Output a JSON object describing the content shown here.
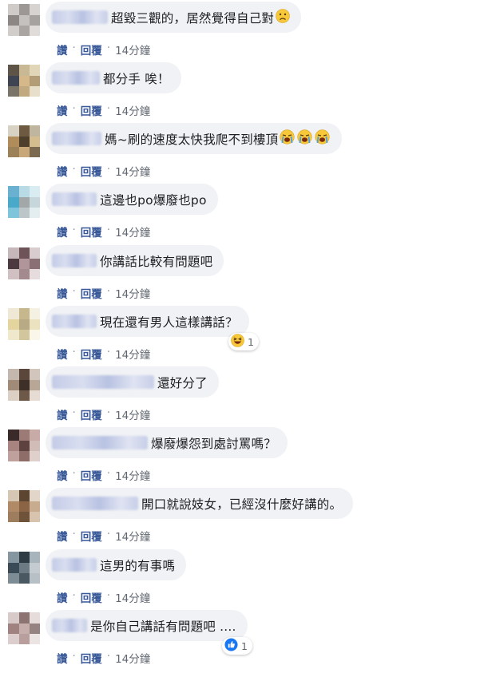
{
  "actions": {
    "like": "讚",
    "reply": "回覆",
    "separator": "·",
    "time": "14分鐘"
  },
  "comments": [
    {
      "text": "超毀三觀的，居然覺得自己對",
      "emoji": "disappointed-face-icon",
      "avatar_color": "#b7b3b1"
    },
    {
      "text": "都分手 唉！",
      "avatar_color": "#a89a7c"
    },
    {
      "text": "媽~刷的速度太快我爬不到樓頂",
      "emoji": "crying-face-icon",
      "emoji_count": 3,
      "avatar_color": "#8a7a5c"
    },
    {
      "text": "這邊也po爆廢也po",
      "avatar_color": "#8fb8c6"
    },
    {
      "text": "你講話比較有問題吧",
      "avatar_color": "#9b8a8c"
    },
    {
      "text": "現在還有男人這樣講話？",
      "reaction": {
        "icon": "haha-reaction-icon",
        "count": "1"
      },
      "avatar_color": "#d8cfae"
    },
    {
      "text": "還好分了",
      "avatar_color": "#8c7a6a"
    },
    {
      "text": "爆廢爆怨到處討罵嗎？",
      "avatar_color": "#7a5a58"
    },
    {
      "text": "開口就說妓女，已經沒什麼好講的。",
      "avatar_color": "#8c6f56"
    },
    {
      "text": "這男的有事嗎",
      "avatar_color": "#4e5e68"
    },
    {
      "text": "是你自己講話有問題吧 ....",
      "reaction": {
        "icon": "like-reaction-icon",
        "count": "1"
      },
      "avatar_color": "#b09a98"
    }
  ],
  "colors": {
    "bubble": "#f0f2f5",
    "action_link": "#385898",
    "time": "#616770"
  }
}
